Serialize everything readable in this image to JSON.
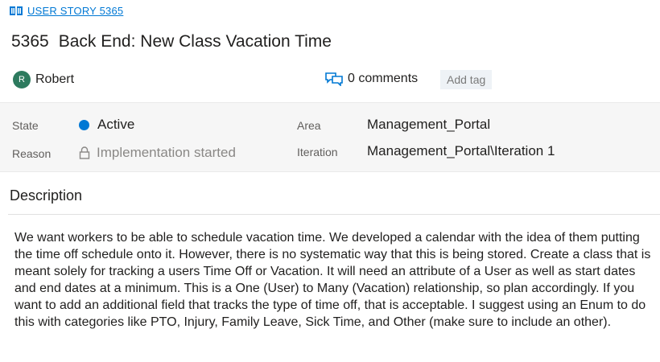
{
  "work_item": {
    "type_label": "USER STORY 5365",
    "id": "5365",
    "title": "Back End: New Class Vacation Time"
  },
  "assignee": {
    "initial": "R",
    "name": "Robert"
  },
  "comments": {
    "label": "0 comments"
  },
  "tags": {
    "add_label": "Add tag"
  },
  "fields": {
    "state": {
      "label": "State",
      "value": "Active",
      "color": "#0078d4"
    },
    "reason": {
      "label": "Reason",
      "value": "Implementation started"
    },
    "area": {
      "label": "Area",
      "value": "Management_Portal"
    },
    "iteration": {
      "label": "Iteration",
      "value": "Management_Portal\\Iteration 1"
    }
  },
  "description": {
    "heading": "Description",
    "body": "We want workers to be able to schedule vacation time. We developed a calendar with the idea of them putting the time off schedule onto it. However, there is no systematic way that this is being stored. Create a class that is meant solely for tracking a users Time Off or Vacation. It will need an attribute of a User as well as start dates and end dates at a minimum. This is a One (User) to Many (Vacation) relationship, so plan accordingly. If you want to add an additional field that tracks the type of time off, that is acceptable. I suggest using an Enum to do this with categories like PTO, Injury, Family Leave, Sick Time, and Other (make sure to include an other)."
  },
  "colors": {
    "accent": "#0078d4",
    "avatar": "#2d7a5e"
  },
  "icons": [
    "book-icon",
    "comments-icon",
    "lock-icon",
    "status-dot-icon"
  ]
}
